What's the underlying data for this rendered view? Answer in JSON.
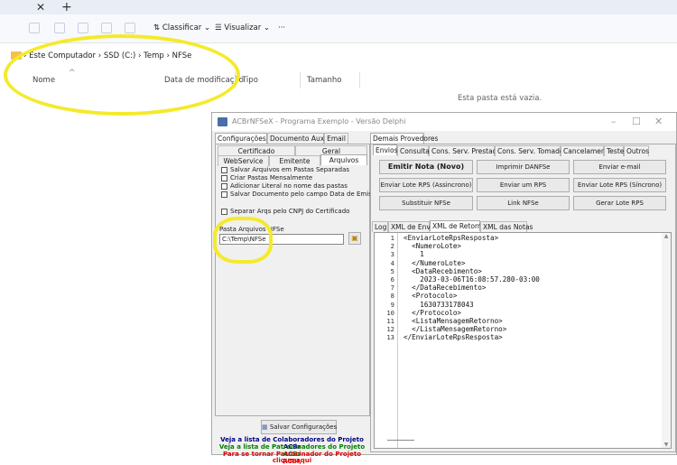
{
  "explorer": {
    "toolbar": {
      "sort_label": "Classificar",
      "view_label": "Visualizar",
      "more_label": "···"
    },
    "breadcrumb": [
      "Este Computador",
      "SSD (C:)",
      "Temp",
      "NFSe"
    ],
    "columns": [
      "Nome",
      "Data de modificação",
      "Tipo",
      "Tamanho"
    ],
    "empty_message": "Esta pasta está vazia."
  },
  "acbr": {
    "title": "ACBrNFSeX - Programa Exemplo - Versão Delphi",
    "left": {
      "tabs_row1": [
        "Configurações",
        "Documento Auxiliar",
        "Email"
      ],
      "tabs_row2": [
        "Certificado",
        "Geral"
      ],
      "tabs_row3": [
        "WebService",
        "Emitente",
        "Arquivos"
      ],
      "checkboxes": [
        "Salvar Arquivos em Pastas Separadas",
        "Criar Pastas Mensalmente",
        "Adicionar Literal no nome das pastas",
        "Salvar Documento pelo campo Data de Emissão",
        "Separar Arqs pelo CNPJ do Certificado"
      ],
      "folder_label": "Pasta Arquivos NFSe",
      "folder_value": "C:\\Temp\\NFSe",
      "save_button": "Salvar Configurações",
      "links": [
        {
          "text": "Veja a lista de Colaboradores do Projeto ACBr",
          "color": "#00007f"
        },
        {
          "text": "Veja a lista de Patrocinadores do Projeto ACBr",
          "color": "#007f00"
        },
        {
          "text": "Para se tornar Patrocinador do Projeto ACBr,",
          "color": "#e00000"
        },
        {
          "text": "clique aqui",
          "color": "#e00000"
        }
      ]
    },
    "right": {
      "top_tab": "Demais Provedores",
      "tabs": [
        "Envios",
        "Consultas",
        "Cons. Serv. Prestados",
        "Cons. Serv. Tomados",
        "Cancelamento",
        "Teste",
        "Outros"
      ],
      "buttons": [
        "Emitir Nota (Novo)",
        "Imprimir DANFSe",
        "Enviar e-mail",
        "Enviar Lote RPS (Assincrono)",
        "Enviar um RPS",
        "Enviar Lote RPS (Síncrono)",
        "Substituir NFSe",
        "Link NFSe",
        "Gerar Lote RPS"
      ],
      "log_tabs": [
        "Log",
        "XML de Envio",
        "XML de Retorno",
        "XML das Notas"
      ],
      "code_lines": [
        "<EnviarLoteRpsResposta>",
        "  <NumeroLote>",
        "    1",
        "  </NumeroLote>",
        "  <DataRecebimento>",
        "    2023-03-06T16:08:57.280-03:00",
        "  </DataRecebimento>",
        "  <Protocolo>",
        "    1630733178043",
        "  </Protocolo>",
        "  <ListaMensagemRetorno>",
        "  </ListaMensagemRetorno>",
        "</EnviarLoteRpsResposta>"
      ],
      "line_numbers": [
        "1",
        "2",
        "3",
        "4",
        "5",
        "6",
        "7",
        "8",
        "9",
        "10",
        "11",
        "12",
        "13"
      ]
    }
  }
}
